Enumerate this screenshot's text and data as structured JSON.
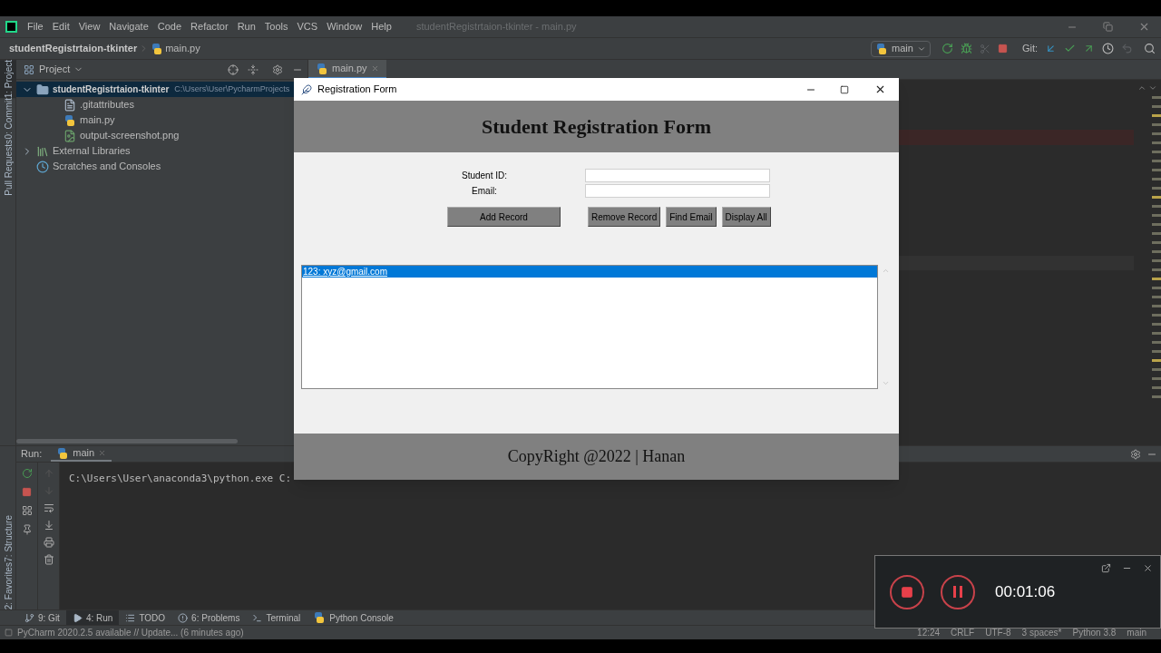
{
  "ide": {
    "menu": [
      "File",
      "Edit",
      "View",
      "Navigate",
      "Code",
      "Refactor",
      "Run",
      "Tools",
      "VCS",
      "Window",
      "Help"
    ],
    "window_title": "studentRegistrtaion-tkinter - main.py",
    "breadcrumbs": [
      "studentRegistrtaion-tkinter",
      "main.py"
    ],
    "run_config": "main",
    "vcs_label": "Git:",
    "left_strip": [
      {
        "label": "1: Project",
        "selected": true
      },
      {
        "label": "0: Commit",
        "selected": false
      },
      {
        "label": "Pull Requests",
        "selected": false
      }
    ],
    "lower_strip": [
      "7: Structure",
      "2: Favorites"
    ],
    "project_panel": {
      "title": "Project",
      "tree": [
        {
          "label": "studentRegistrtaion-tkinter",
          "path": "C:\\Users\\User\\PycharmProjects",
          "kind": "folder",
          "expanded": true,
          "selected": true,
          "children": [
            {
              "label": ".gitattributes",
              "kind": "text",
              "selected": false
            },
            {
              "label": "main.py",
              "kind": "python",
              "selected": false
            },
            {
              "label": "output-screenshot.png",
              "kind": "image",
              "selected": false
            }
          ]
        },
        {
          "label": "External Libraries",
          "kind": "library",
          "expanded": false,
          "selected": false
        },
        {
          "label": "Scratches and Consoles",
          "kind": "scratches",
          "selected": false
        }
      ]
    },
    "editor_tabs": [
      {
        "label": "main.py",
        "selected": true
      }
    ],
    "run_panel": {
      "label": "Run:",
      "tab": "main",
      "output": "C:\\Users\\User\\anaconda3\\python.exe C:"
    },
    "bottom_tabs": [
      {
        "label": "9: Git",
        "kind": "git",
        "selected": false
      },
      {
        "label": "4: Run",
        "kind": "run",
        "selected": true
      },
      {
        "label": "TODO",
        "kind": "todo",
        "selected": false
      },
      {
        "label": "6: Problems",
        "kind": "problems",
        "selected": false
      },
      {
        "label": "Terminal",
        "kind": "terminal",
        "selected": false
      },
      {
        "label": "Python Console",
        "kind": "python",
        "selected": false
      }
    ],
    "status": {
      "message": "PyCharm 2020.2.5 available // Update... (6 minutes ago)",
      "items": [
        "12:24",
        "CRLF",
        "UTF-8",
        "3 spaces*",
        "Python 3.8",
        "main"
      ]
    }
  },
  "tk_window": {
    "title": "Registration Form",
    "heading": "Student Registration Form",
    "fields": [
      {
        "label": "Student ID:"
      },
      {
        "label": "Email:"
      }
    ],
    "buttons": [
      "Add Record",
      "Remove Record",
      "Find Email",
      "Display All"
    ],
    "list": [
      {
        "text": "123: xyz@gmail.com",
        "selected": true
      }
    ],
    "footer": "CopyRight @2022 | Hanan"
  },
  "recorder": {
    "time": "00:01:06"
  }
}
